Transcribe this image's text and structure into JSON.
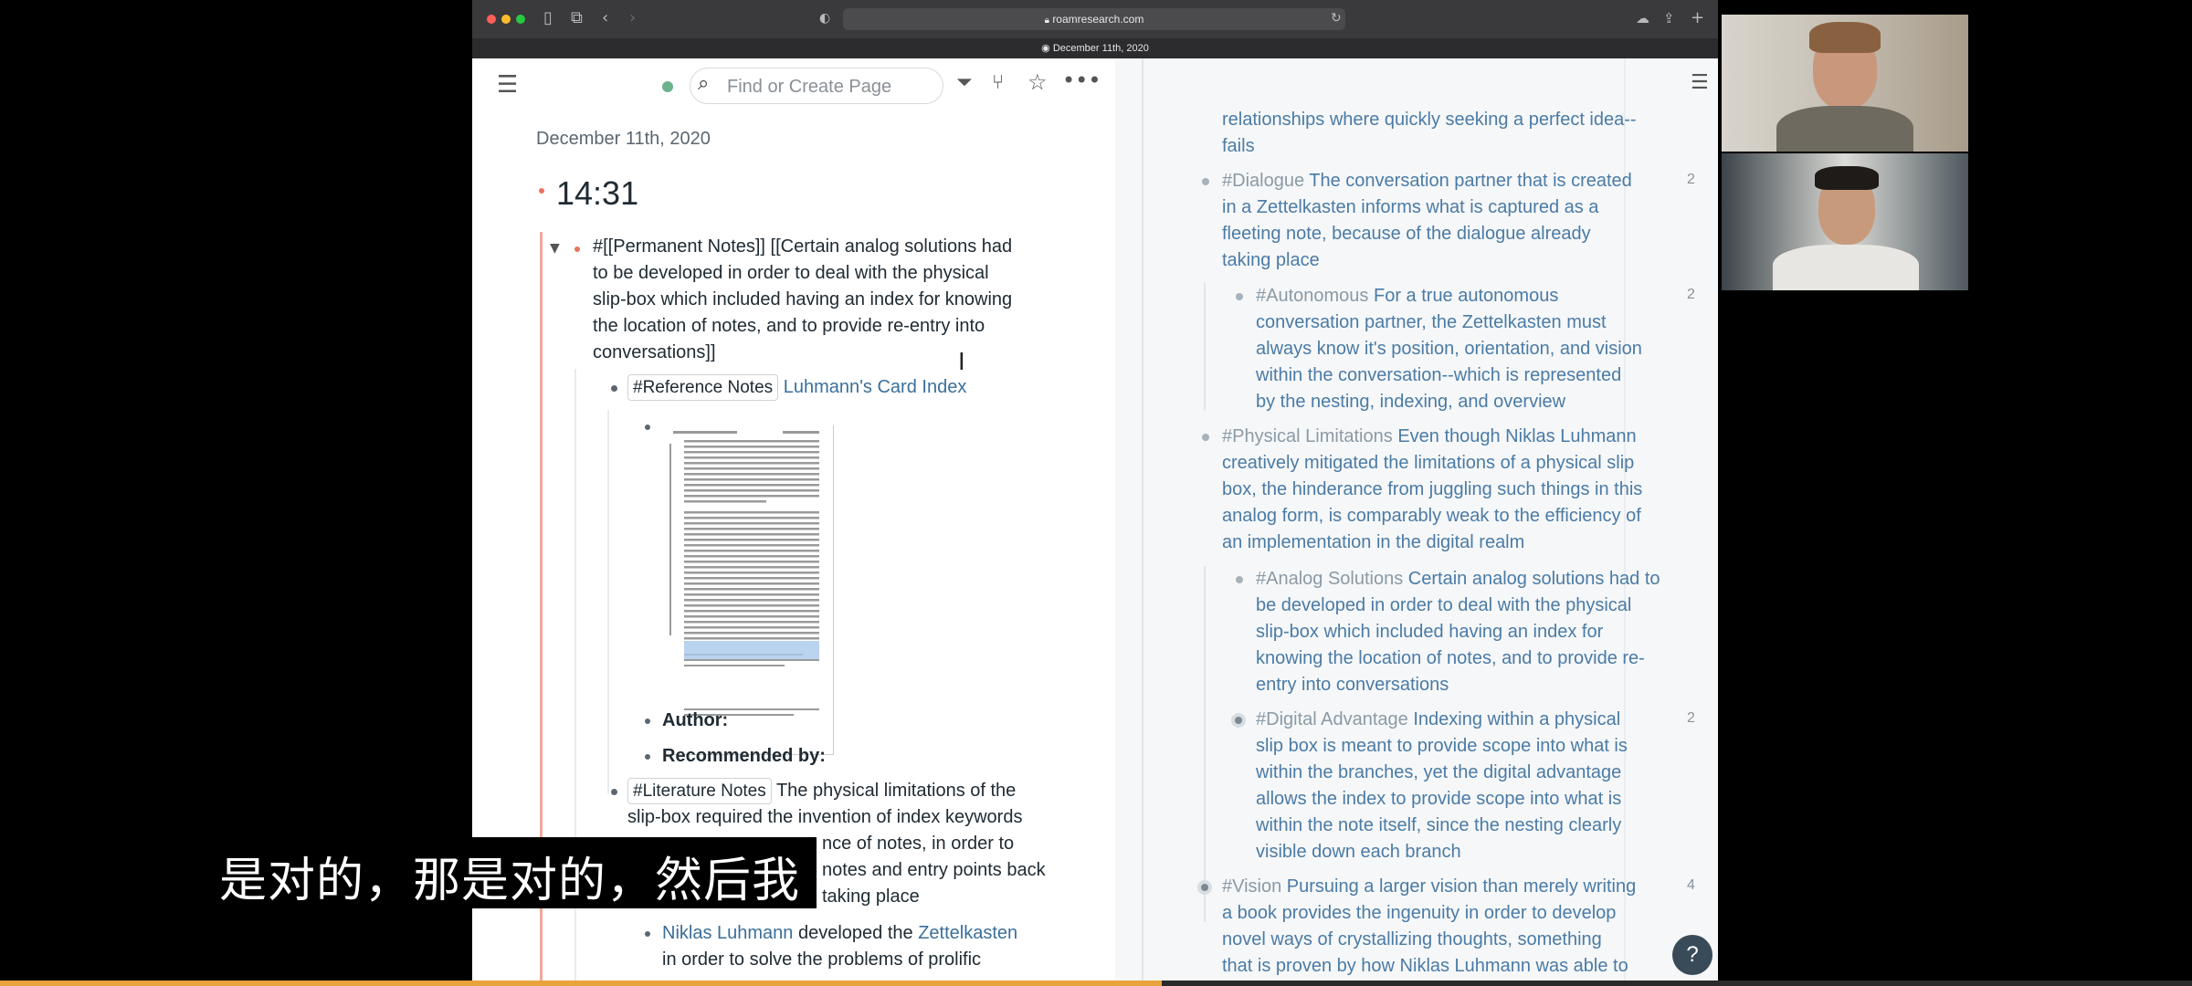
{
  "browser": {
    "url": "roamresearch.com",
    "tab_title": "December 11th, 2020"
  },
  "topbar": {
    "search_placeholder": "Find or Create Page"
  },
  "page": {
    "date": "December 11th, 2020",
    "time": "14:31",
    "permanent_note": {
      "tag": "#[[Permanent Notes]]",
      "lines": [
        "[[Certain analog solutions had",
        "to be developed in order to deal with the physical",
        "slip-box which included having an index for knowing",
        "the location of notes, and to provide re-entry into",
        "conversations]]"
      ]
    },
    "reference": {
      "chip": "#Reference Notes",
      "link": "Luhmann's Card Index",
      "author_label": "Author:",
      "recommended_label": "Recommended by:"
    },
    "literature": {
      "chip": "#Literature Notes",
      "first_line": "The physical limitations of the",
      "lines": [
        "slip-box required the invention of index keywords",
        "nce of notes, in order to",
        "notes and entry points back",
        "taking place"
      ]
    },
    "luhmann": {
      "link1": "Niklas Luhmann",
      "mid": "developed the",
      "link2": "Zettelkasten",
      "line2": "in order to solve the problems of prolific"
    }
  },
  "sidebar": {
    "top_lines": [
      "relationships where quickly seeking a perfect idea--",
      "fails"
    ],
    "blocks": [
      {
        "tag": "#Dialogue",
        "count": "2",
        "lines": [
          "The conversation partner that is created",
          "in a Zettelkasten informs what is captured as a",
          "fleeting note, because of the dialogue already",
          "taking place"
        ]
      },
      {
        "tag": "#Autonomous",
        "count": "2",
        "lines": [
          "For a true autonomous",
          "conversation partner, the Zettelkasten must",
          "always know it's position, orientation, and vision",
          "within the conversation--which is represented",
          "by the nesting, indexing, and overview"
        ]
      },
      {
        "tag": "#Physical Limitations",
        "count": "",
        "lines": [
          "Even though Niklas Luhmann",
          "creatively mitigated the limitations of a physical slip",
          "box, the hinderance from juggling such things in this",
          "analog form, is comparably weak to the efficiency of",
          "an implementation in the digital realm"
        ]
      },
      {
        "tag": "#Analog Solutions",
        "count": "",
        "lines": [
          "Certain analog solutions had to",
          "be developed in order to deal with the physical",
          "slip-box which included having an index for",
          "knowing the location of notes, and to provide re-",
          "entry into conversations"
        ]
      },
      {
        "tag": "#Digital Advantage",
        "count": "2",
        "lines": [
          "Indexing within a physical",
          "slip box is meant to provide scope into what is",
          "within the branches, yet the digital advantage",
          "allows the index to provide scope into what is",
          "within the note itself, since the nesting clearly",
          "visible down each branch"
        ]
      },
      {
        "tag": "#Vision",
        "count": "4",
        "lines": [
          "Pursuing a larger vision than merely writing",
          "a book provides the ingenuity in order to develop",
          "novel ways of crystallizing thoughts, something",
          "that is proven by how Niklas Luhmann was able to"
        ]
      }
    ],
    "help": "?"
  },
  "subtitle": "是对的，那是对的，然后我",
  "video_progress": 0.53,
  "colors": {
    "accent": "#3a6f9a",
    "progress": "#e8a33d"
  }
}
